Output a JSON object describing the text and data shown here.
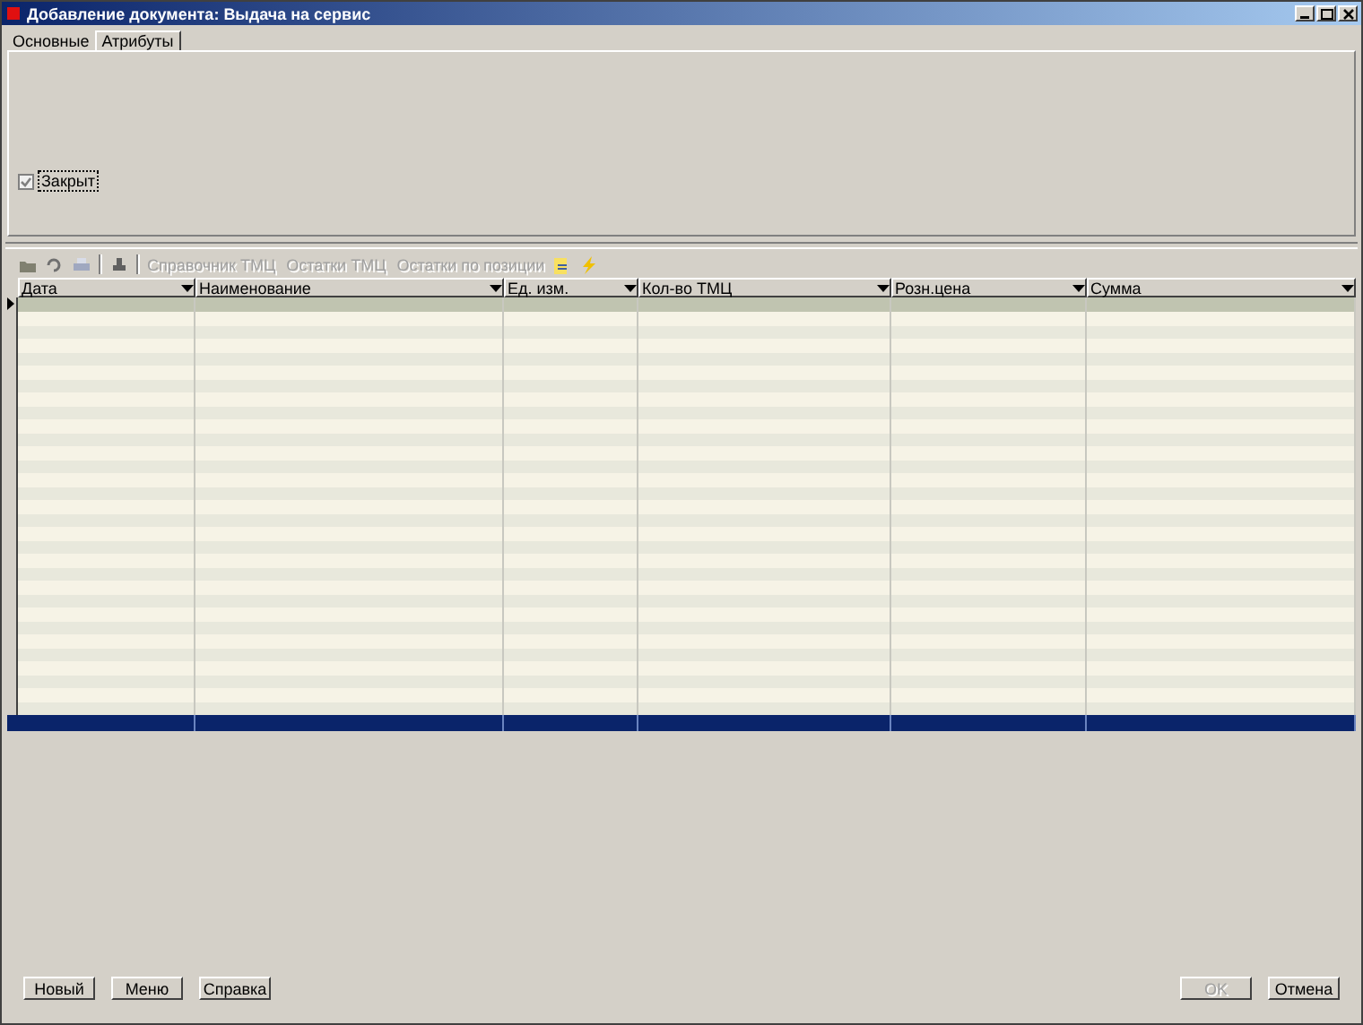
{
  "window": {
    "title": "Добавление документа: Выдача на сервис"
  },
  "tabs": [
    {
      "label": "Основные",
      "selected": false
    },
    {
      "label": "Атрибуты",
      "selected": true
    }
  ],
  "closed_checkbox": {
    "label": "Закрыт",
    "checked": true
  },
  "toolbar": {
    "text_buttons": [
      {
        "label": "Справочник ТМЦ",
        "disabled": true
      },
      {
        "label": "Остатки ТМЦ",
        "disabled": true
      },
      {
        "label": "Остатки по позиции",
        "disabled": true
      }
    ]
  },
  "table": {
    "columns": [
      {
        "label": "Дата"
      },
      {
        "label": "Наименование"
      },
      {
        "label": "Ед. изм."
      },
      {
        "label": "Кол-во ТМЦ"
      },
      {
        "label": "Розн.цена"
      },
      {
        "label": "Сумма"
      }
    ]
  },
  "buttons_left": [
    {
      "label": "Новый",
      "disabled": false
    },
    {
      "label": "Меню",
      "disabled": false
    },
    {
      "label": "Справка",
      "disabled": false
    }
  ],
  "buttons_right": [
    {
      "label": "OK",
      "disabled": true
    },
    {
      "label": "Отмена",
      "disabled": false
    }
  ]
}
